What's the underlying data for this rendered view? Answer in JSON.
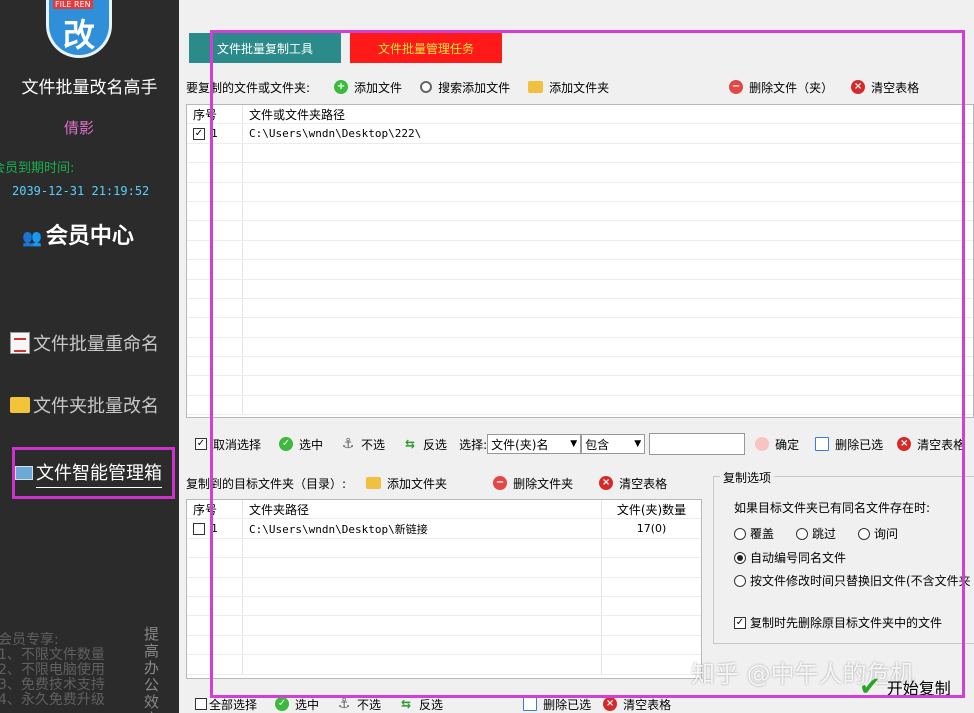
{
  "sidebar": {
    "logo_badge": "FILE REN",
    "logo_char": "改",
    "app_name": "文件批量改名高手",
    "user_name": "倩影",
    "expiry_label": "会员到期时间:",
    "expiry_value": "2039-12-31  21:19:52",
    "vip_center": "会员中心",
    "nav": [
      {
        "label": "文件批量重命名",
        "icon": "document-icon"
      },
      {
        "label": "文件夹批量改名",
        "icon": "folder-icon"
      },
      {
        "label": "文件智能管理箱",
        "icon": "photo-icon"
      }
    ],
    "promo_lines": [
      "会员专享:",
      "1、不限文件数量",
      "2、不限电脑使用",
      "3、免费技术支持",
      "4、永久免费升级"
    ],
    "promo_vertical": "提高办公效率"
  },
  "tabs": [
    {
      "label": "文件批量复制工具"
    },
    {
      "label": "文件批量管理任务"
    }
  ],
  "source": {
    "label": "要复制的文件或文件夹:",
    "add_file": "添加文件",
    "search_add": "搜索添加文件",
    "add_folder": "添加文件夹",
    "delete": "删除文件（夹）",
    "clear": "清空表格",
    "columns": [
      "序号",
      "文件或文件夹路径"
    ],
    "rows": [
      {
        "index": "1",
        "path": "C:\\Users\\wndn\\Desktop\\222\\",
        "checked": true
      }
    ]
  },
  "filter_bar": {
    "cancel_select": "取消选择",
    "select": "选中",
    "unselect": "不选",
    "invert": "反选",
    "choose_label": "选择:",
    "field_value": "文件(夹)名",
    "mode_value": "包含",
    "confirm": "确定",
    "delete_selected": "删除已选",
    "clear": "清空表格"
  },
  "target": {
    "label": "复制到的目标文件夹（目录）:",
    "add_folder": "添加文件夹",
    "delete_folder": "删除文件夹",
    "clear": "清空表格",
    "columns": [
      "序号",
      "文件夹路径",
      "文件(夹)数量"
    ],
    "rows": [
      {
        "index": "1",
        "path": "C:\\Users\\wndn\\Desktop\\新链接",
        "count": "17(0)",
        "checked": false
      }
    ]
  },
  "options": {
    "title": "复制选项",
    "question": "如果目标文件夹已有同名文件存在时:",
    "overwrite": "覆盖",
    "skip": "跳过",
    "ask": "询问",
    "auto_number": "自动编号同名文件",
    "by_time": "按文件修改时间只替换旧文件(不含文件夹",
    "delete_first": "复制时先删除原目标文件夹中的文件",
    "selected_option": "自动编号同名文件",
    "delete_first_checked": true
  },
  "bottom_bar": {
    "select_all": "全部选择",
    "select": "选中",
    "unselect": "不选",
    "invert": "反选",
    "delete_selected": "删除已选",
    "clear": "清空表格"
  },
  "start_button": "开始复制",
  "watermark": "知乎 @中午人的危机",
  "colors": {
    "sidebar_bg": "#2b2b2b",
    "tab1_bg": "#2b8a8a",
    "tab2_bg": "#ff1a1a",
    "tab2_text": "#ffe640",
    "highlight": "#d23fd2",
    "user_name": "#e070c8",
    "expiry_label": "#19b04f"
  }
}
